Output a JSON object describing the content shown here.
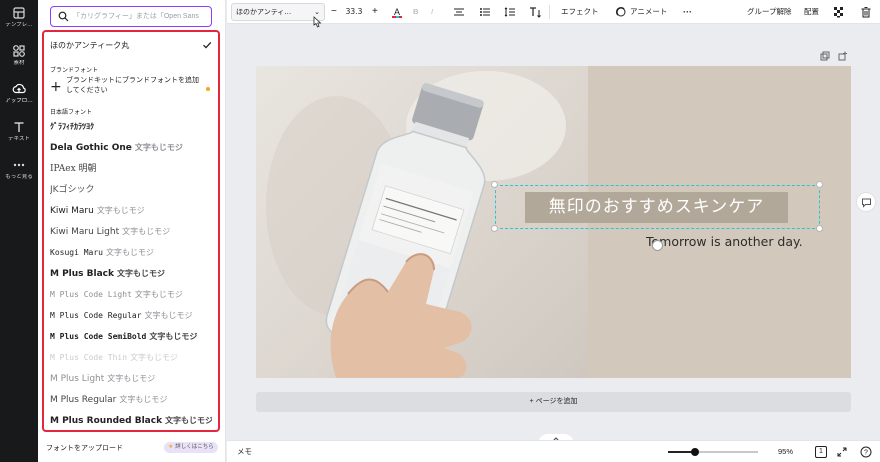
{
  "rail": {
    "items": [
      {
        "label": "テンプレ…",
        "icon": "template-icon"
      },
      {
        "label": "素材",
        "icon": "elements-icon"
      },
      {
        "label": "アップロ…",
        "icon": "upload-icon"
      },
      {
        "label": "テキスト",
        "icon": "text-icon"
      },
      {
        "label": "もっと見る",
        "icon": "more-icon"
      }
    ]
  },
  "panel": {
    "search_placeholder": "「カリグラフィー」または「Open Sans",
    "selected_font": "ほのかアンティーク丸",
    "brand_section": "ブランドフォント",
    "brand_cta": "ブランドキットにブランドフォントを追加してください",
    "japanese_section": "日本語フォント",
    "fonts": [
      {
        "name": "ｸﾞﾗﾌｨﾁｶﾗﾂﾖｸ",
        "sample": ""
      },
      {
        "name": "Dela Gothic One",
        "sample": "文字もじモジ"
      },
      {
        "name": "IPAex 明朝",
        "sample": ""
      },
      {
        "name": "JKゴシック",
        "sample": ""
      },
      {
        "name": "Kiwi Maru",
        "sample": "文字もじモジ"
      },
      {
        "name": "Kiwi Maru Light",
        "sample": "文字もじモジ"
      },
      {
        "name": "Kosugi Maru",
        "sample": "文字もじモジ"
      },
      {
        "name": "M Plus Black",
        "sample": "文字もじモジ"
      },
      {
        "name": "M Plus Code Light",
        "sample": "文字もじモジ"
      },
      {
        "name": "M Plus Code Regular",
        "sample": "文字もじモジ"
      },
      {
        "name": "M Plus Code SemiBold",
        "sample": "文字もじモジ"
      },
      {
        "name": "M Plus Code Thin",
        "sample": "文字もじモジ"
      },
      {
        "name": "M Plus Light",
        "sample": "文字もじモジ"
      },
      {
        "name": "M Plus Regular",
        "sample": "文字もじモジ"
      },
      {
        "name": "M Plus Rounded Black",
        "sample": "文字もじモジ"
      }
    ],
    "upload_label": "フォントをアップロード",
    "pro_pill": "詳しくはこちら"
  },
  "toolbar": {
    "font_name": "ほのかアンティ…",
    "font_size": "33.3",
    "effects": "エフェクト",
    "animate": "アニメート",
    "ungroup": "グループ解除",
    "position": "配置"
  },
  "canvas": {
    "title": "無印のおすすめスキンケア",
    "subtitle": "Tomorrow is another day.",
    "add_page": "+ ページを追加"
  },
  "bottombar": {
    "notes": "メモ",
    "zoom": "95%",
    "zoom_fraction": 0.3,
    "page_count": "1"
  },
  "colors": {
    "accent": "#8b3dff",
    "highlight": "#e3263d",
    "selection": "#29c5d4",
    "title_band": "#b2a899",
    "beige": "#d2c9bc"
  }
}
